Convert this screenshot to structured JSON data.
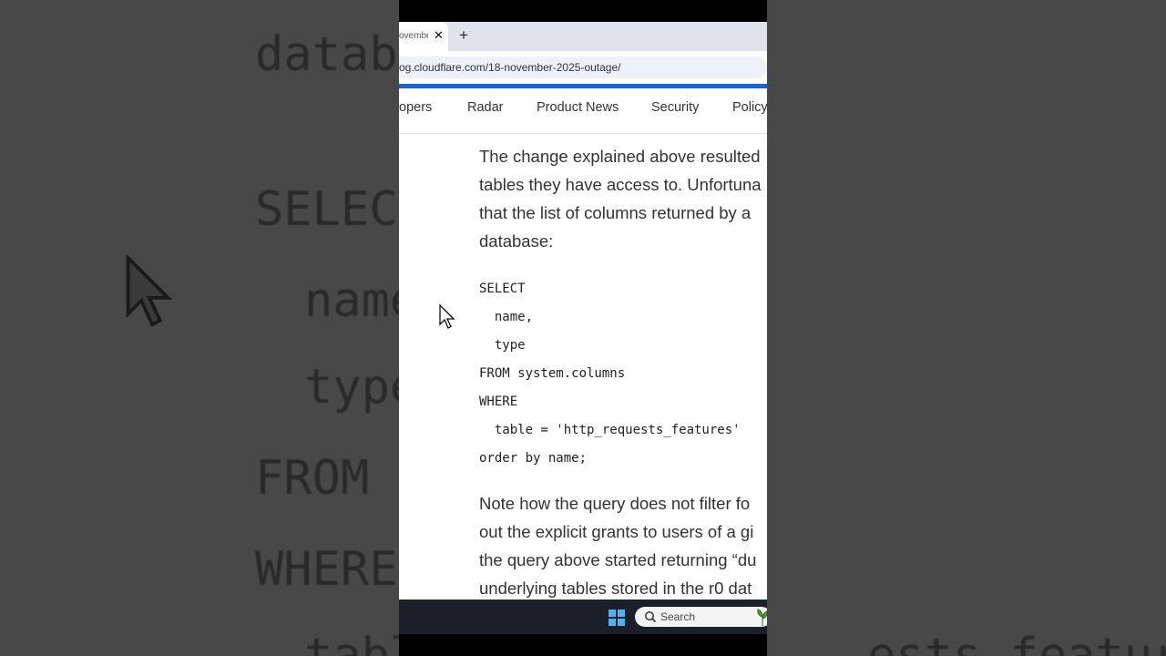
{
  "browser": {
    "tab_title": "ovembe",
    "tab_close": "✕",
    "new_tab": "+",
    "url": "og.cloudflare.com/18-november-2025-outage/"
  },
  "nav": {
    "items": [
      "opers",
      "Radar",
      "Product News",
      "Security",
      "Policy"
    ]
  },
  "article": {
    "para1": [
      "The change explained above resulted",
      "tables they have access to. Unfortuna",
      "that the list of columns returned by a",
      "database:"
    ],
    "code": [
      "SELECT",
      "  name,",
      "  type",
      "FROM system.columns",
      "WHERE",
      "  table = 'http_requests_features'",
      "order by name;"
    ],
    "para2": [
      "Note how the query does not filter fo",
      "out the explicit grants to users of a gi",
      "the query above started returning “du",
      "underlying tables stored in the r0 dat"
    ]
  },
  "taskbar": {
    "search_label": "Search",
    "start_icon": "windows-start-icon",
    "search_icon": "search-icon"
  },
  "background": {
    "left_lines": [
      "datab",
      "SELECT",
      "name",
      "type",
      "FROM s",
      "WHERE",
      "tabl"
    ],
    "right_lines": [
      "ests_features'"
    ]
  }
}
